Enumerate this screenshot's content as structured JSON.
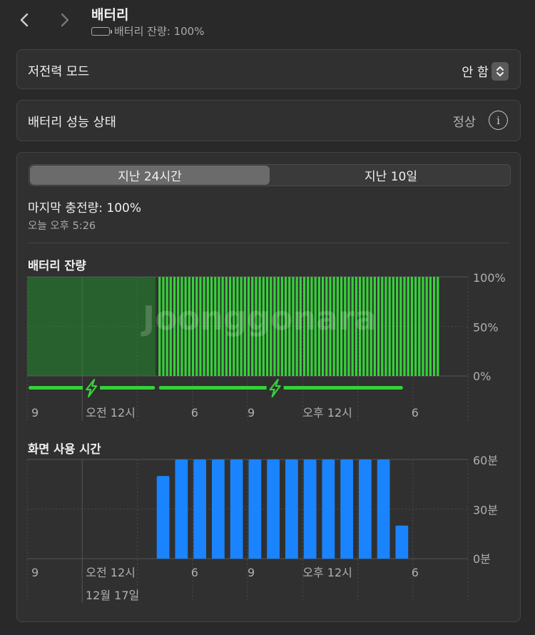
{
  "header": {
    "back_icon": "chevron-left-icon",
    "forward_icon": "chevron-right-icon",
    "title": "배터리",
    "battery_icon": "battery-full-icon",
    "subtitle": "배터리 잔량: 100%"
  },
  "low_power": {
    "label": "저전력 모드",
    "value": "안 함",
    "icon": "up-down-chevron-icon"
  },
  "health": {
    "label": "배터리 성능 상태",
    "value": "정상",
    "icon": "info-icon"
  },
  "tabs": [
    {
      "label": "지난 24시간",
      "active": true
    },
    {
      "label": "지난 10일",
      "active": false
    }
  ],
  "last_charge": {
    "label": "마지막 충전량: 100%",
    "time": "오늘 오후 5:26"
  },
  "battery_chart": {
    "title": "배터리 잔량"
  },
  "screen_chart": {
    "title": "화면 사용 시간"
  },
  "watermark": "Joonggonara",
  "chart_data": [
    {
      "type": "bar",
      "title": "배터리 잔량",
      "x_ticks": [
        "9",
        "오전 12시",
        "6",
        "9",
        "오후 12시",
        "6"
      ],
      "y_ticks": [
        "100%",
        "50%",
        "0%"
      ],
      "ylim": [
        0,
        100
      ],
      "x_unit": "hour_index",
      "x_range": [
        0,
        24
      ],
      "charging_region": [
        0,
        7
      ],
      "bar_start": 7.15,
      "bar_end": 22.5,
      "bar_count": 76,
      "values_percent": 100,
      "charging_lines": [
        [
          0,
          7
        ],
        [
          7.1,
          20.5
        ]
      ],
      "charging_icons": [
        3.5,
        13.5
      ],
      "colors": {
        "bar": "#36d13a",
        "charging": "#1f9e2a",
        "line": "#36d13a"
      }
    },
    {
      "type": "bar",
      "title": "화면 사용 시간",
      "x_ticks": [
        "9",
        "오전 12시",
        "6",
        "9",
        "오후 12시",
        "6"
      ],
      "y_ticks": [
        "60분",
        "30분",
        "0분"
      ],
      "date_label": "12월 17일",
      "ylim": [
        0,
        60
      ],
      "x_unit": "hour_index",
      "categories": [
        7,
        8,
        9,
        10,
        11,
        12,
        13,
        14,
        15,
        16,
        17,
        18,
        19,
        20
      ],
      "values": [
        50,
        60,
        60,
        60,
        60,
        60,
        60,
        60,
        60,
        60,
        60,
        60,
        60,
        20
      ],
      "colors": {
        "bar": "#1a84ff"
      }
    }
  ]
}
